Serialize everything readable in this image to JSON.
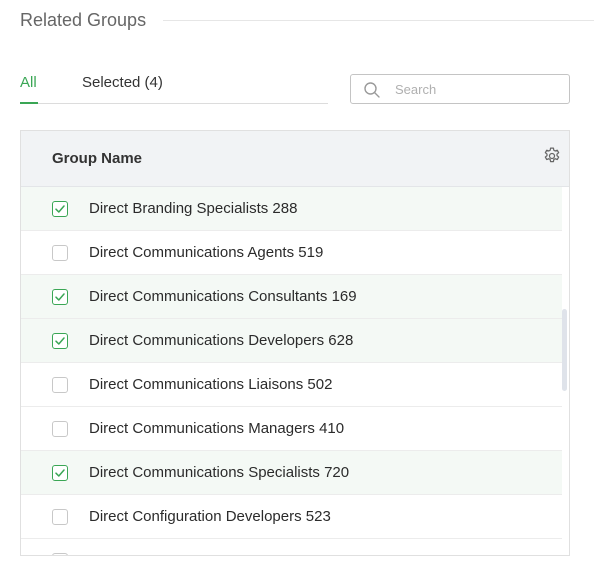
{
  "section": {
    "title": "Related Groups"
  },
  "tabs": [
    {
      "label": "All",
      "active": true
    },
    {
      "label": "Selected (4)",
      "active": false
    }
  ],
  "search": {
    "placeholder": "Search",
    "value": ""
  },
  "table": {
    "column_header": "Group Name",
    "rows": [
      {
        "label": "Direct Branding Specialists 288",
        "checked": true
      },
      {
        "label": "Direct Communications Agents 519",
        "checked": false
      },
      {
        "label": "Direct Communications Consultants 169",
        "checked": true
      },
      {
        "label": "Direct Communications Developers 628",
        "checked": true
      },
      {
        "label": "Direct Communications Liaisons 502",
        "checked": false
      },
      {
        "label": "Direct Communications Managers 410",
        "checked": false
      },
      {
        "label": "Direct Communications Specialists 720",
        "checked": true
      },
      {
        "label": "Direct Configuration Developers 523",
        "checked": false
      }
    ]
  },
  "colors": {
    "accent": "#3aa655",
    "header_bg": "#f1f3f5",
    "checked_row_bg": "#f4f9f5"
  },
  "icons": {
    "search": "search-icon",
    "settings": "gear-icon",
    "check": "checkmark-icon"
  }
}
